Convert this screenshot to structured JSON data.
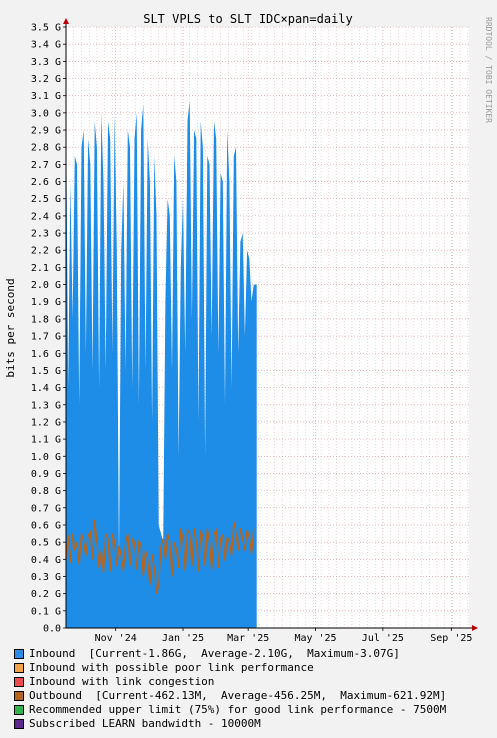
{
  "chart_data": {
    "type": "area",
    "title": "SLT VPLS to SLT IDC×pan=daily",
    "ylabel": "bits per second",
    "watermark": "RRDTOOL / TOBI OETIKER",
    "ylim": [
      0,
      3.5
    ],
    "yunit": "G",
    "yticks": [
      "0.0",
      "0.1 G",
      "0.2 G",
      "0.3 G",
      "0.4 G",
      "0.5 G",
      "0.6 G",
      "0.7 G",
      "0.8 G",
      "0.9 G",
      "1.0 G",
      "1.1 G",
      "1.2 G",
      "1.3 G",
      "1.4 G",
      "1.5 G",
      "1.6 G",
      "1.7 G",
      "1.8 G",
      "1.9 G",
      "2.0 G",
      "2.1 G",
      "2.2 G",
      "2.3 G",
      "2.4 G",
      "2.5 G",
      "2.6 G",
      "2.7 G",
      "2.8 G",
      "2.9 G",
      "3.0 G",
      "3.1 G",
      "3.2 G",
      "3.3 G",
      "3.4 G",
      "3.5 G"
    ],
    "xlim": [
      "2024-10-01",
      "2025-10-01"
    ],
    "xticks": [
      {
        "date": "2024-11-15",
        "label": "Nov '24"
      },
      {
        "date": "2025-01-15",
        "label": "Jan '25"
      },
      {
        "date": "2025-03-15",
        "label": "Mar '25"
      },
      {
        "date": "2025-05-15",
        "label": "May '25"
      },
      {
        "date": "2025-07-15",
        "label": "Jul '25"
      },
      {
        "date": "2025-09-15",
        "label": "Sep '25"
      }
    ],
    "grid": true,
    "colors": {
      "inbound": "#1e8de8",
      "outbound": "#b5651d",
      "grid_minor": "#e6bdbd",
      "grid_major": "#d89595",
      "axis": "#c00000"
    },
    "x": [
      "2024-10-01",
      "2024-10-03",
      "2024-10-05",
      "2024-10-07",
      "2024-10-09",
      "2024-10-11",
      "2024-10-13",
      "2024-10-15",
      "2024-10-17",
      "2024-10-19",
      "2024-10-21",
      "2024-10-23",
      "2024-10-25",
      "2024-10-27",
      "2024-10-29",
      "2024-10-31",
      "2024-11-02",
      "2024-11-04",
      "2024-11-06",
      "2024-11-08",
      "2024-11-10",
      "2024-11-12",
      "2024-11-14",
      "2024-11-16",
      "2024-11-18",
      "2024-11-20",
      "2024-11-22",
      "2024-11-24",
      "2024-11-26",
      "2024-11-28",
      "2024-11-30",
      "2024-12-02",
      "2024-12-04",
      "2024-12-06",
      "2024-12-08",
      "2024-12-10",
      "2024-12-12",
      "2024-12-14",
      "2024-12-16",
      "2024-12-18",
      "2024-12-20",
      "2024-12-22",
      "2024-12-24",
      "2024-12-26",
      "2024-12-28",
      "2024-12-30",
      "2025-01-01",
      "2025-01-03",
      "2025-01-05",
      "2025-01-07",
      "2025-01-09",
      "2025-01-11",
      "2025-01-13",
      "2025-01-15",
      "2025-01-17",
      "2025-01-19",
      "2025-01-21",
      "2025-01-23",
      "2025-01-25",
      "2025-01-27",
      "2025-01-29",
      "2025-01-31",
      "2025-02-02",
      "2025-02-04",
      "2025-02-06",
      "2025-02-08",
      "2025-02-10",
      "2025-02-12",
      "2025-02-14",
      "2025-02-16",
      "2025-02-18",
      "2025-02-20",
      "2025-02-22",
      "2025-02-24",
      "2025-02-26",
      "2025-02-28",
      "2025-03-02",
      "2025-03-04",
      "2025-03-06",
      "2025-03-08",
      "2025-03-10",
      "2025-03-12",
      "2025-03-14",
      "2025-03-16",
      "2025-03-18",
      "2025-03-20"
    ],
    "series": [
      {
        "name": "Inbound",
        "key": "inbound",
        "values": [
          3.05,
          1.4,
          2.6,
          1.8,
          2.75,
          2.7,
          1.3,
          2.8,
          2.9,
          1.6,
          2.85,
          2.7,
          1.5,
          2.95,
          2.8,
          1.4,
          3.0,
          2.6,
          1.5,
          2.95,
          2.85,
          1.6,
          3.0,
          2.2,
          0.4,
          2.2,
          2.6,
          1.5,
          2.9,
          2.8,
          1.4,
          2.85,
          3.0,
          1.3,
          2.9,
          3.05,
          1.5,
          2.85,
          2.6,
          1.2,
          2.75,
          2.4,
          0.6,
          0.55,
          0.5,
          1.9,
          2.5,
          2.4,
          1.5,
          2.75,
          2.6,
          1.0,
          2.1,
          2.5,
          1.6,
          2.95,
          3.07,
          1.8,
          2.9,
          2.85,
          1.2,
          2.95,
          2.8,
          1.0,
          2.75,
          2.7,
          1.7,
          2.95,
          2.85,
          1.6,
          2.65,
          2.6,
          1.3,
          2.9,
          2.6,
          1.4,
          2.75,
          2.8,
          1.6,
          2.25,
          2.3,
          1.7,
          2.2,
          2.15,
          1.9,
          2.0
        ]
      },
      {
        "name": "Outbound",
        "key": "outbound",
        "values": [
          0.4,
          0.54,
          0.38,
          0.55,
          0.45,
          0.5,
          0.37,
          0.55,
          0.5,
          0.42,
          0.54,
          0.56,
          0.4,
          0.63,
          0.5,
          0.35,
          0.45,
          0.32,
          0.55,
          0.52,
          0.33,
          0.55,
          0.5,
          0.36,
          0.48,
          0.42,
          0.33,
          0.5,
          0.55,
          0.36,
          0.52,
          0.5,
          0.34,
          0.51,
          0.48,
          0.3,
          0.45,
          0.4,
          0.25,
          0.43,
          0.35,
          0.2,
          0.25,
          0.48,
          0.52,
          0.4,
          0.55,
          0.5,
          0.3,
          0.5,
          0.46,
          0.35,
          0.58,
          0.52,
          0.33,
          0.57,
          0.55,
          0.36,
          0.58,
          0.5,
          0.33,
          0.56,
          0.54,
          0.36,
          0.58,
          0.5,
          0.34,
          0.55,
          0.57,
          0.35,
          0.52,
          0.54,
          0.39,
          0.53,
          0.5,
          0.42,
          0.62,
          0.55,
          0.45,
          0.58,
          0.52,
          0.45,
          0.57,
          0.53,
          0.43,
          0.58
        ]
      }
    ]
  },
  "legend": [
    {
      "label": "Inbound  [Current-1.86G,  Average-2.10G,  Maximum-3.07G]",
      "color": "#2b8ee6"
    },
    {
      "label": "Inbound with possible poor link performance",
      "color": "#f2a24a"
    },
    {
      "label": "Inbound with link congestion",
      "color": "#e84c4c"
    },
    {
      "label": "Outbound  [Current-462.13M,  Average-456.25M,  Maximum-621.92M]",
      "color": "#b5651d"
    },
    {
      "label": "Recommended upper limit (75%) for good link performance - 7500M",
      "color": "#2fb34a"
    },
    {
      "label": "Subscribed LEARN bandwidth - 10000M",
      "color": "#5b2a8c"
    }
  ]
}
